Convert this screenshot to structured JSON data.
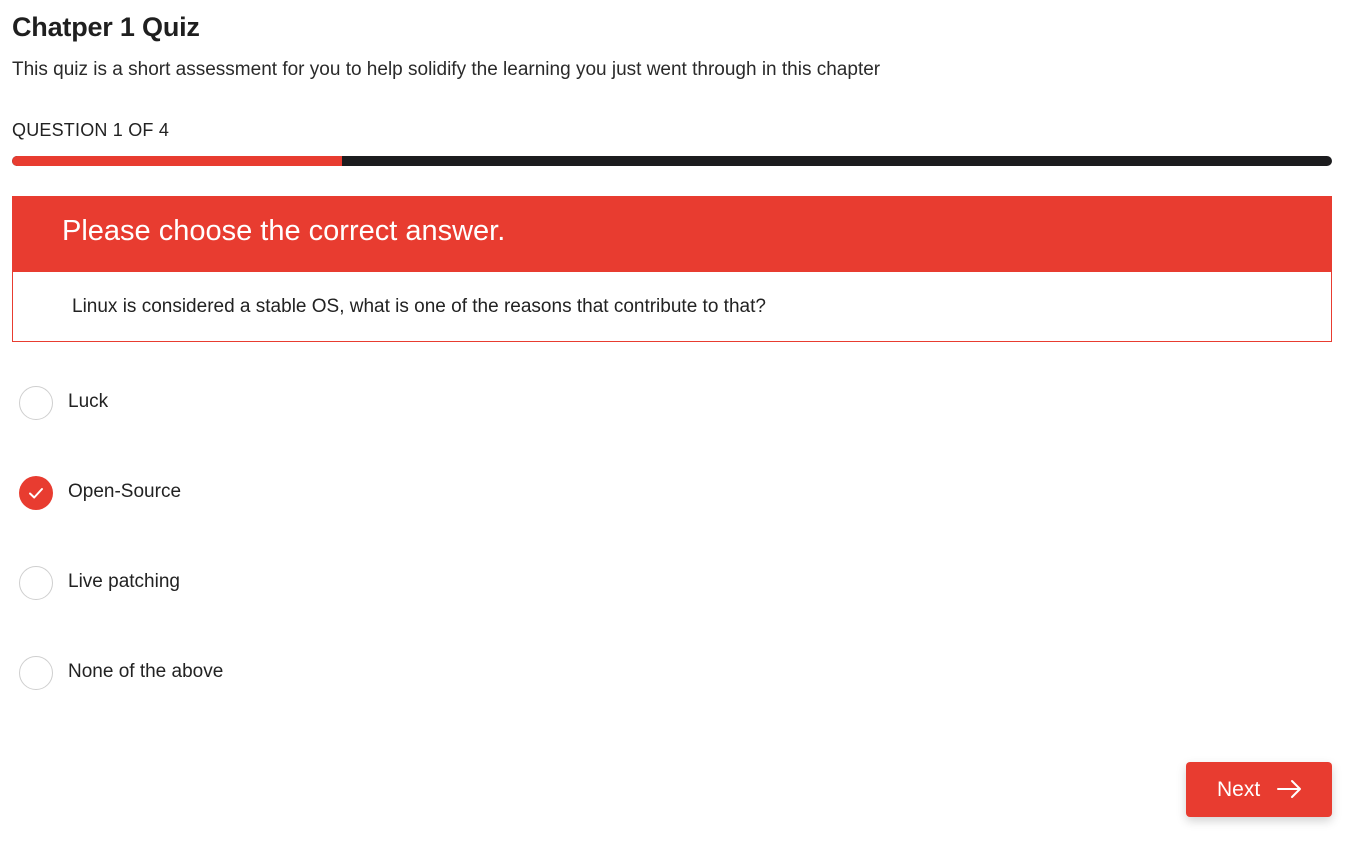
{
  "quiz": {
    "title": "Chatper 1 Quiz",
    "subtitle": "This quiz is a short assessment for you to help solidify the learning you just went through in this chapter"
  },
  "progress": {
    "label": "QUESTION 1 OF 4",
    "current": 1,
    "total": 4,
    "fraction": 0.25
  },
  "question": {
    "prompt": "Please choose the correct answer.",
    "text": "Linux is considered a stable OS, what is one of the reasons that contribute to that?"
  },
  "options": [
    {
      "label": "Luck",
      "selected": false
    },
    {
      "label": "Open-Source",
      "selected": true
    },
    {
      "label": "Live patching",
      "selected": false
    },
    {
      "label": "None of the above",
      "selected": false
    }
  ],
  "navigation": {
    "next_label": "Next",
    "next_icon": "arrow-right-icon"
  },
  "colors": {
    "accent": "#e83c30",
    "track": "#1c1c1e",
    "text": "#222222"
  }
}
